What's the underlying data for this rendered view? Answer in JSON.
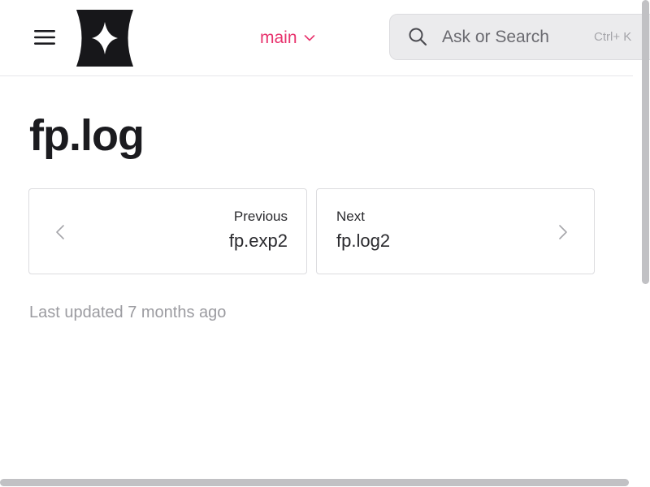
{
  "header": {
    "branch_label": "main",
    "search": {
      "placeholder": "Ask or Search",
      "shortcut": "Ctrl+ K"
    }
  },
  "page": {
    "title": "fp.log",
    "last_updated": "Last updated 7 months ago"
  },
  "pagination": {
    "previous": {
      "caption": "Previous",
      "name": "fp.exp2"
    },
    "next": {
      "caption": "Next",
      "name": "fp.log2"
    }
  },
  "colors": {
    "accent": "#e8336d",
    "text": "#1b1b1f",
    "muted": "#9b9ba0",
    "search_bg": "#ebebed"
  },
  "icons": {
    "menu": "hamburger-icon",
    "logo": "four-point-star-logo",
    "branch": "chevron-down-icon",
    "search": "search-icon",
    "prev": "chevron-left-icon",
    "next": "chevron-right-icon"
  }
}
